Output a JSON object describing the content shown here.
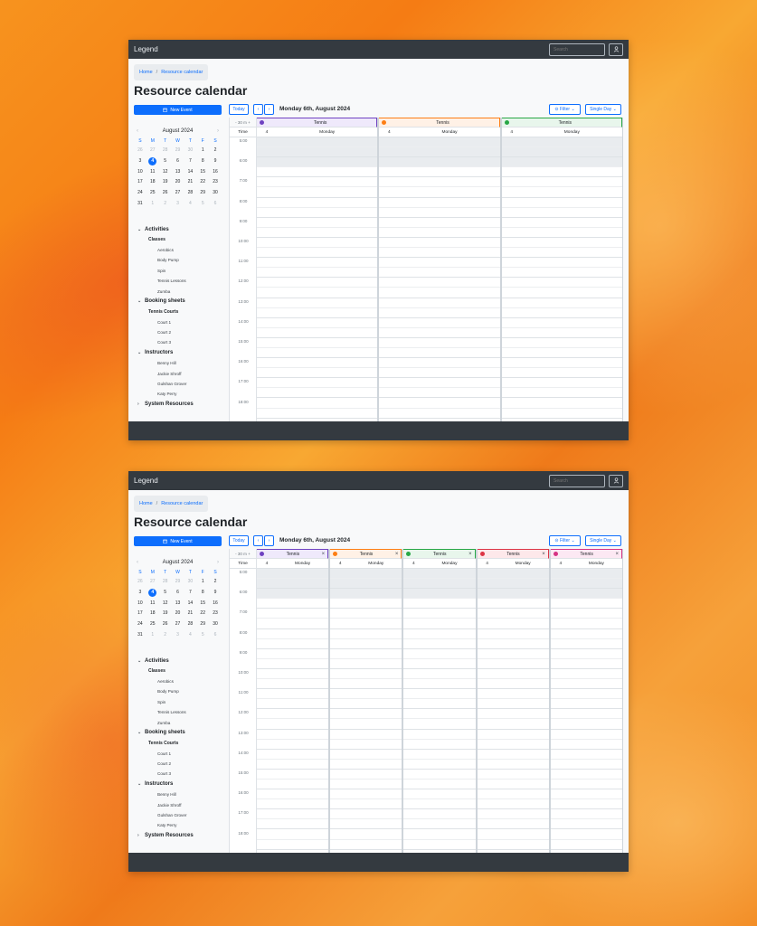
{
  "navbar": {
    "brand": "Legend",
    "search_placeholder": "Search"
  },
  "breadcrumb": {
    "home": "Home",
    "separator": "/",
    "current": "Resource calendar"
  },
  "page_title": "Resource calendar",
  "new_event_label": "New Event",
  "mini_calendar": {
    "month": "August 2024",
    "prev": "‹",
    "next": "›",
    "weekdays": [
      "S",
      "M",
      "T",
      "W",
      "T",
      "F",
      "S"
    ],
    "weeks": [
      [
        {
          "d": "26",
          "m": true
        },
        {
          "d": "27",
          "m": true
        },
        {
          "d": "28",
          "m": true
        },
        {
          "d": "29",
          "m": true
        },
        {
          "d": "30",
          "m": true
        },
        {
          "d": "1"
        },
        {
          "d": "2"
        }
      ],
      [
        {
          "d": "3"
        },
        {
          "d": "4",
          "today": true
        },
        {
          "d": "5"
        },
        {
          "d": "6"
        },
        {
          "d": "7"
        },
        {
          "d": "8"
        },
        {
          "d": "9"
        }
      ],
      [
        {
          "d": "10"
        },
        {
          "d": "11"
        },
        {
          "d": "12"
        },
        {
          "d": "13"
        },
        {
          "d": "14"
        },
        {
          "d": "15"
        },
        {
          "d": "16"
        }
      ],
      [
        {
          "d": "17"
        },
        {
          "d": "18"
        },
        {
          "d": "19"
        },
        {
          "d": "20"
        },
        {
          "d": "21"
        },
        {
          "d": "22"
        },
        {
          "d": "23"
        }
      ],
      [
        {
          "d": "24"
        },
        {
          "d": "25"
        },
        {
          "d": "26"
        },
        {
          "d": "27"
        },
        {
          "d": "28"
        },
        {
          "d": "29"
        },
        {
          "d": "30"
        }
      ],
      [
        {
          "d": "31"
        },
        {
          "d": "1",
          "m": true
        },
        {
          "d": "2",
          "m": true
        },
        {
          "d": "3",
          "m": true
        },
        {
          "d": "4",
          "m": true
        },
        {
          "d": "5",
          "m": true
        },
        {
          "d": "6",
          "m": true
        }
      ]
    ]
  },
  "tree": [
    {
      "type": "grp",
      "label": "Activities",
      "chev": "⌄"
    },
    {
      "type": "sub",
      "label": "Classes"
    },
    {
      "type": "leaf",
      "label": "Aerobics"
    },
    {
      "type": "leaf",
      "label": "Body Pump"
    },
    {
      "type": "leaf",
      "label": "Spin"
    },
    {
      "type": "leaf",
      "label": "Tennis Lessons"
    },
    {
      "type": "leaf",
      "label": "Zumba"
    },
    {
      "type": "grp",
      "label": "Booking sheets",
      "chev": "⌄"
    },
    {
      "type": "sub",
      "label": "Tennis Courts"
    },
    {
      "type": "leaf",
      "label": "Court 1"
    },
    {
      "type": "leaf",
      "label": "Court 2"
    },
    {
      "type": "leaf",
      "label": "Court 3"
    },
    {
      "type": "grp",
      "label": "Instructors",
      "chev": "⌄"
    },
    {
      "type": "leaf",
      "label": "Benny Hill"
    },
    {
      "type": "leaf",
      "label": "Jackie Shroff"
    },
    {
      "type": "leaf",
      "label": "Gulshan Grover"
    },
    {
      "type": "leaf",
      "label": "Katy Perry"
    },
    {
      "type": "grp",
      "label": "System Resources",
      "chev": "›"
    }
  ],
  "toolbar": {
    "today": "Today",
    "prev": "‹",
    "next": "›",
    "date": "Monday 6th, August 2024",
    "filter": "Filter ⌄",
    "view": "Single Day ⌄"
  },
  "time_col": {
    "interval": "- 30 m +",
    "header": "Time",
    "hours": [
      "5:00",
      "6:00",
      "7:00",
      "8:00",
      "9:00",
      "10:00",
      "11:00",
      "12:00",
      "13:00",
      "14:00",
      "15:00",
      "16:00",
      "17:00",
      "18:00"
    ]
  },
  "screens": [
    {
      "columns": [
        {
          "name": "Tennis",
          "color": "#6f42c1",
          "bg": "#efe9fb",
          "num": "4",
          "day": "Monday",
          "close": false
        },
        {
          "name": "Tennis",
          "color": "#fd7e14",
          "bg": "#fff1e6",
          "num": "4",
          "day": "Monday",
          "close": false
        },
        {
          "name": "Tennis",
          "color": "#28a745",
          "bg": "#e8f6ec",
          "num": "4",
          "day": "Monday",
          "close": false
        }
      ]
    },
    {
      "columns": [
        {
          "name": "Tennis",
          "color": "#6f42c1",
          "bg": "#efe9fb",
          "num": "4",
          "day": "Monday",
          "close": true
        },
        {
          "name": "Tennis",
          "color": "#fd7e14",
          "bg": "#fff1e6",
          "num": "4",
          "day": "Monday",
          "close": true
        },
        {
          "name": "Tennis",
          "color": "#28a745",
          "bg": "#e8f6ec",
          "num": "4",
          "day": "Monday",
          "close": true
        },
        {
          "name": "Tennis",
          "color": "#dc3545",
          "bg": "#fde8ea",
          "num": "4",
          "day": "Monday",
          "close": true
        },
        {
          "name": "Tennis",
          "color": "#d63384",
          "bg": "#fce8f3",
          "num": "4",
          "day": "Monday",
          "close": true
        }
      ]
    }
  ],
  "close_glyph": "×"
}
